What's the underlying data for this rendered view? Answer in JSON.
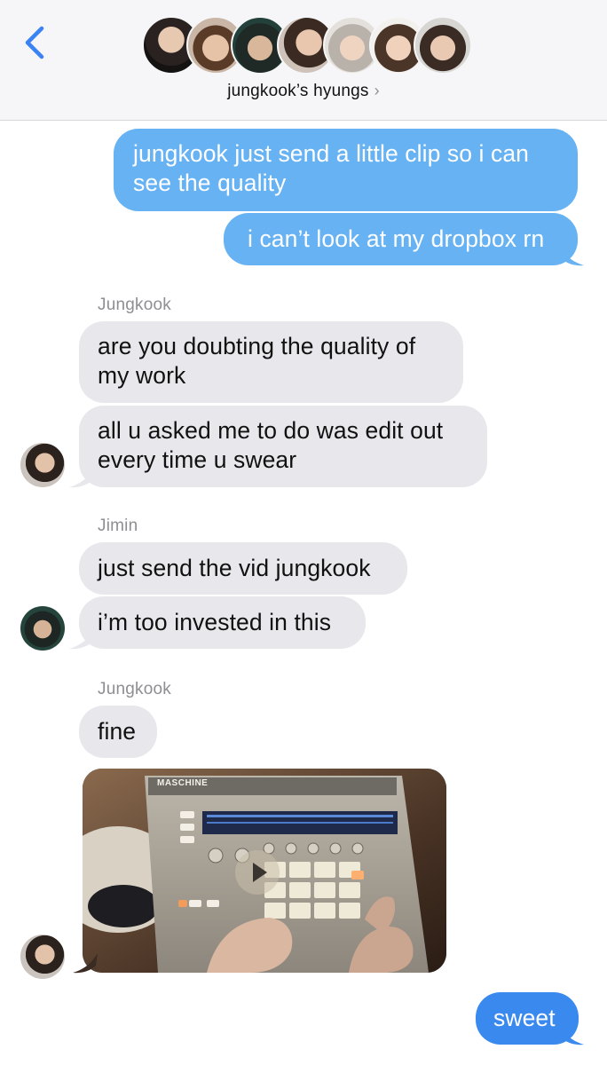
{
  "header": {
    "back_icon": "chevron-left-icon",
    "group_name": "jungkook’s hyungs",
    "disclosure_icon": "chevron-right-icon",
    "accent": "#3b82f6"
  },
  "messages": {
    "m1": {
      "text_line1": "jungkook just send a little clip so i can",
      "text_line2": "see the quality"
    },
    "m2": {
      "text": "i can’t look at my dropbox rn"
    },
    "sender1": "Jungkook",
    "m3": {
      "text_line1": "are you doubting the quality of",
      "text_line2": "my work"
    },
    "m4": {
      "text_line1": "all u asked me to do was edit out",
      "text_line2": "every time u swear"
    },
    "sender2": "Jimin",
    "m5": {
      "text": "just send the vid jungkook"
    },
    "m6": {
      "text": "i’m too invested in this"
    },
    "sender3": "Jungkook",
    "m7": {
      "text": "fine"
    },
    "video": {
      "brand_text": "MASCHINE",
      "play_icon": "play-icon"
    },
    "m8": {
      "text": "sweet"
    }
  },
  "colors": {
    "outgoing_bubble": "#66b2f3",
    "incoming_bubble": "#e8e8ec",
    "sender_label": "#8e8e93"
  }
}
